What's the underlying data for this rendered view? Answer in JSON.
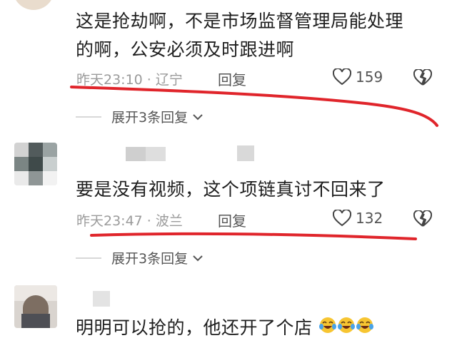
{
  "colors": {
    "accent_line": "#e0252b",
    "meta_gray": "#9b9b9b",
    "text": "#1f1f1f"
  },
  "comments": [
    {
      "text_line1": "这是抢劫啊，不是市场监督管理局能处理",
      "text_line2": "的啊，公安必须及时跟进啊",
      "time": "昨天23:10",
      "location": "辽宁",
      "reply_label": "回复",
      "likes": "159",
      "expand_label": "展开3条回复"
    },
    {
      "text": "要是没有视频，这个项链真讨不回来了",
      "time": "昨天23:47",
      "location": "波兰",
      "reply_label": "回复",
      "likes": "132",
      "expand_label": "展开3条回复"
    },
    {
      "text": "明明可以抢的，他还开了个店",
      "emojis": [
        "laugh-cry-emoji",
        "laugh-cry-emoji",
        "laugh-cry-emoji"
      ]
    }
  ],
  "separator": " · "
}
